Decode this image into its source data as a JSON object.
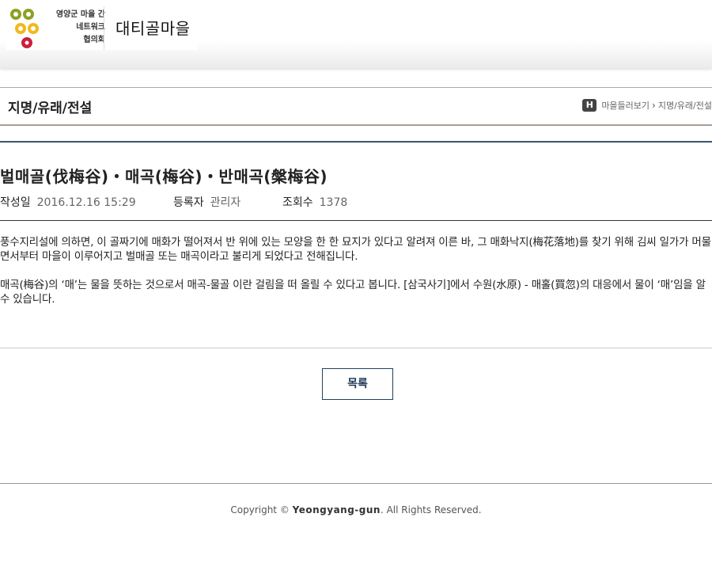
{
  "header": {
    "logo_text_lines": [
      "영양군 마을 간",
      "네트워크",
      "협의회"
    ],
    "village_name": "대티골마을"
  },
  "titlebar": {
    "heading": "지명/유래/전설",
    "breadcrumb": {
      "home_icon_label": "H",
      "items": [
        "마을들러보기",
        "지명/유래/전설"
      ],
      "separator": "›"
    }
  },
  "post": {
    "title": "벌매골(伐梅谷)・매곡(梅谷)・반매곡(槃梅谷)",
    "meta": {
      "date_label": "작성일",
      "date_value": "2016.12.16 15:29",
      "author_label": "등록자",
      "author_value": "관리자",
      "views_label": "조회수",
      "views_value": "1378"
    },
    "paragraphs": [
      "풍수지리설에 의하면, 이 골짜기에 매화가 떨어져서 반 위에 있는 모양을 한 한 묘지가 있다고 알려져 이른 바, 그 매화낙지(梅花落地)를 찾기 위해 김씨 일가가 머물면서부터 마을이 이루어지고 벌매골 또는 매곡이라고 불리게 되었다고 전해집니다.",
      "매곡(梅谷)의 ‘매’는 물을 뜻하는 것으로서 매곡-물골 이란 걸림을 떠 올릴 수 있다고 봅니다. [삼국사기]에서 수원(水原) - 매홀(買忽)의 대응에서 물이 ‘매’임을 알 수 있습니다."
    ]
  },
  "list_button_label": "목록",
  "footer": {
    "prefix": "Copyright © ",
    "brand": "Yeongyang-gun",
    "suffix": ". All Rights Reserved."
  },
  "colors": {
    "logo_olive": "#8ea023",
    "logo_yellow": "#f2b81c",
    "logo_red": "#cc1f3b",
    "rule_blue": "#3a5572",
    "button_border": "#1f4260"
  }
}
